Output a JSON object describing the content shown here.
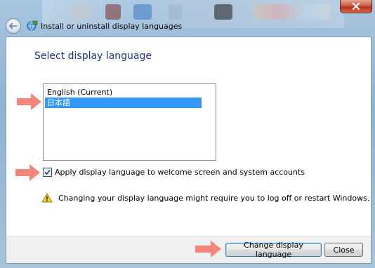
{
  "window": {
    "breadcrumb": "Install or uninstall display languages"
  },
  "page": {
    "heading": "Select display language"
  },
  "languages": [
    {
      "label": "English (Current)",
      "selected": false
    },
    {
      "label": "日本語",
      "selected": true
    }
  ],
  "apply_checkbox": {
    "label": "Apply display language to welcome screen and system accounts",
    "checked": true
  },
  "warning": {
    "text": "Changing your display language might require you to log off or restart Windows."
  },
  "buttons": {
    "change": "Change display language",
    "close": "Close"
  },
  "colors": {
    "heading": "#1e3287",
    "selection": "#3399ff",
    "annotation_arrow": "#f4857a"
  }
}
